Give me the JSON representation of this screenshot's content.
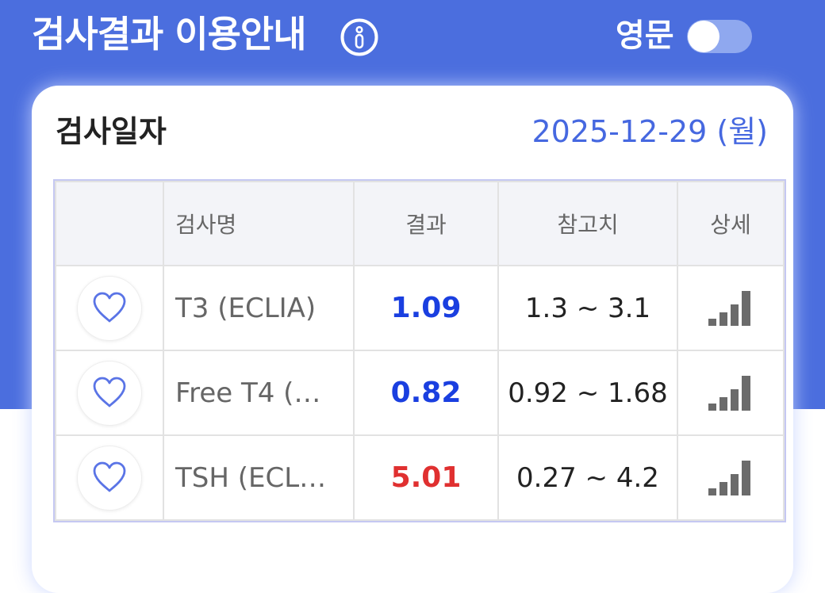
{
  "header": {
    "title": "검사결과 이용안내",
    "info_icon": "info-circle-icon"
  },
  "lang_toggle": {
    "label": "영문",
    "on": false
  },
  "card": {
    "date_label": "검사일자",
    "date_value": "2025-12-29 (월)",
    "columns": [
      "",
      "검사명",
      "결과",
      "참고치",
      "상세"
    ],
    "rows": [
      {
        "name": "T3 (ECLIA)",
        "result": "1.09",
        "result_color": "#1a3fe0",
        "range": "1.3 ~ 3.1"
      },
      {
        "name": "Free T4 (…",
        "result": "0.82",
        "result_color": "#1a3fe0",
        "range": "0.92 ~ 1.68"
      },
      {
        "name": "TSH (ECL…",
        "result": "5.01",
        "result_color": "#e03030",
        "range": "0.27 ~ 4.2"
      }
    ]
  },
  "colors": {
    "brand": "#4b6ede",
    "date": "#4668e0",
    "low": "#1a3fe0",
    "high": "#e03030"
  }
}
